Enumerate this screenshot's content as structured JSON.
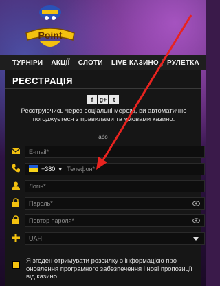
{
  "brand": {
    "logo_text": "Point"
  },
  "nav": {
    "items": [
      "ТУРНІРИ",
      "АКЦІЇ",
      "СЛОТИ",
      "LIVE КАЗИНО",
      "РУЛЕТКА"
    ]
  },
  "registration": {
    "title": "РЕЄСТРАЦІЯ",
    "social": [
      "f",
      "g+",
      "t"
    ],
    "notice": "Реєструючись через соціальні мережі, ви автоматично погоджуєтеся з правилами та умовами казино.",
    "divider": "або",
    "email_placeholder": "E-mail*",
    "phone_code": "+380",
    "phone_placeholder": "Телефон*",
    "login_placeholder": "Логін*",
    "password_placeholder": "Пароль*",
    "password_repeat_placeholder": "Повтор пароля*",
    "currency": "UAH",
    "consent_text": "Я згоден отримувати розсилку з інформацією про оновлення програмного забезпечення і нові пропозиції від казино."
  },
  "colors": {
    "accent": "#f3c10f",
    "arrow": "#e8231f"
  }
}
